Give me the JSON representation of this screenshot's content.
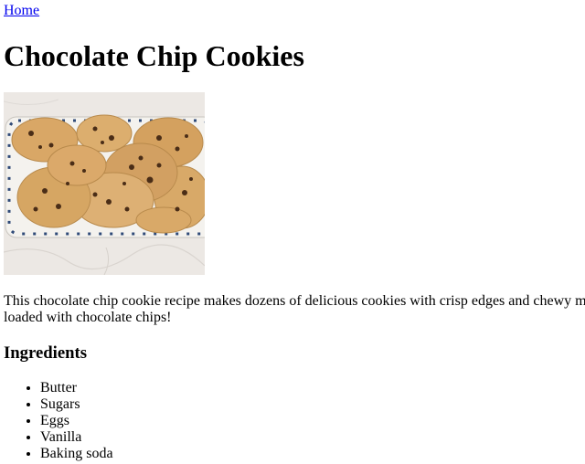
{
  "nav": {
    "home_label": "Home"
  },
  "recipe": {
    "title": "Chocolate Chip Cookies",
    "image_subject": "plate-of-chocolate-chip-cookies",
    "description_line1": "This chocolate chip cookie recipe makes dozens of delicious cookies with crisp edges and chewy m",
    "description_line2": "loaded with chocolate chips!"
  },
  "ingredients": {
    "heading": "Ingredients",
    "items": [
      "Butter",
      "Sugars",
      "Eggs",
      "Vanilla",
      "Baking soda"
    ]
  },
  "colors": {
    "link": "#0000EE",
    "text": "#000000",
    "background": "#ffffff"
  }
}
